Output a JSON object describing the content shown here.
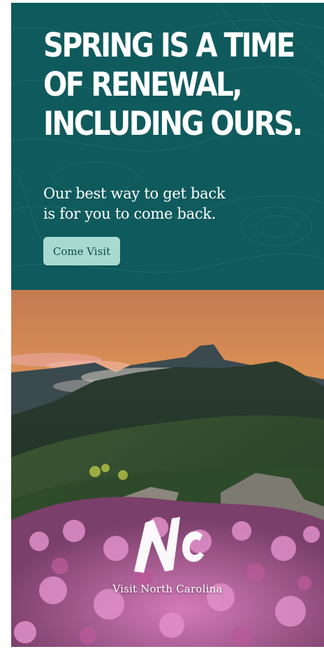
{
  "ad": {
    "headline_lines": [
      "SPRING IS A TIME",
      "OF RENEWAL,",
      "INCLUDING OURS."
    ],
    "subhead_lines": [
      "Our best way to get back",
      "is for you to come back."
    ],
    "cta_label": "Come Visit",
    "logo_caption": "Visit North Carolina",
    "logo_mark": "NC"
  },
  "colors": {
    "panel": "#0f5a5c",
    "cta_bg": "#a7d9d0",
    "cta_text": "#0f4a4c",
    "sky_top": "#d98a4a",
    "sky_glow": "#f7b04a",
    "flowers": "#c96bb0"
  },
  "icons": {
    "logo": "nc-logo-icon",
    "background_pattern": "topographic-lines"
  }
}
